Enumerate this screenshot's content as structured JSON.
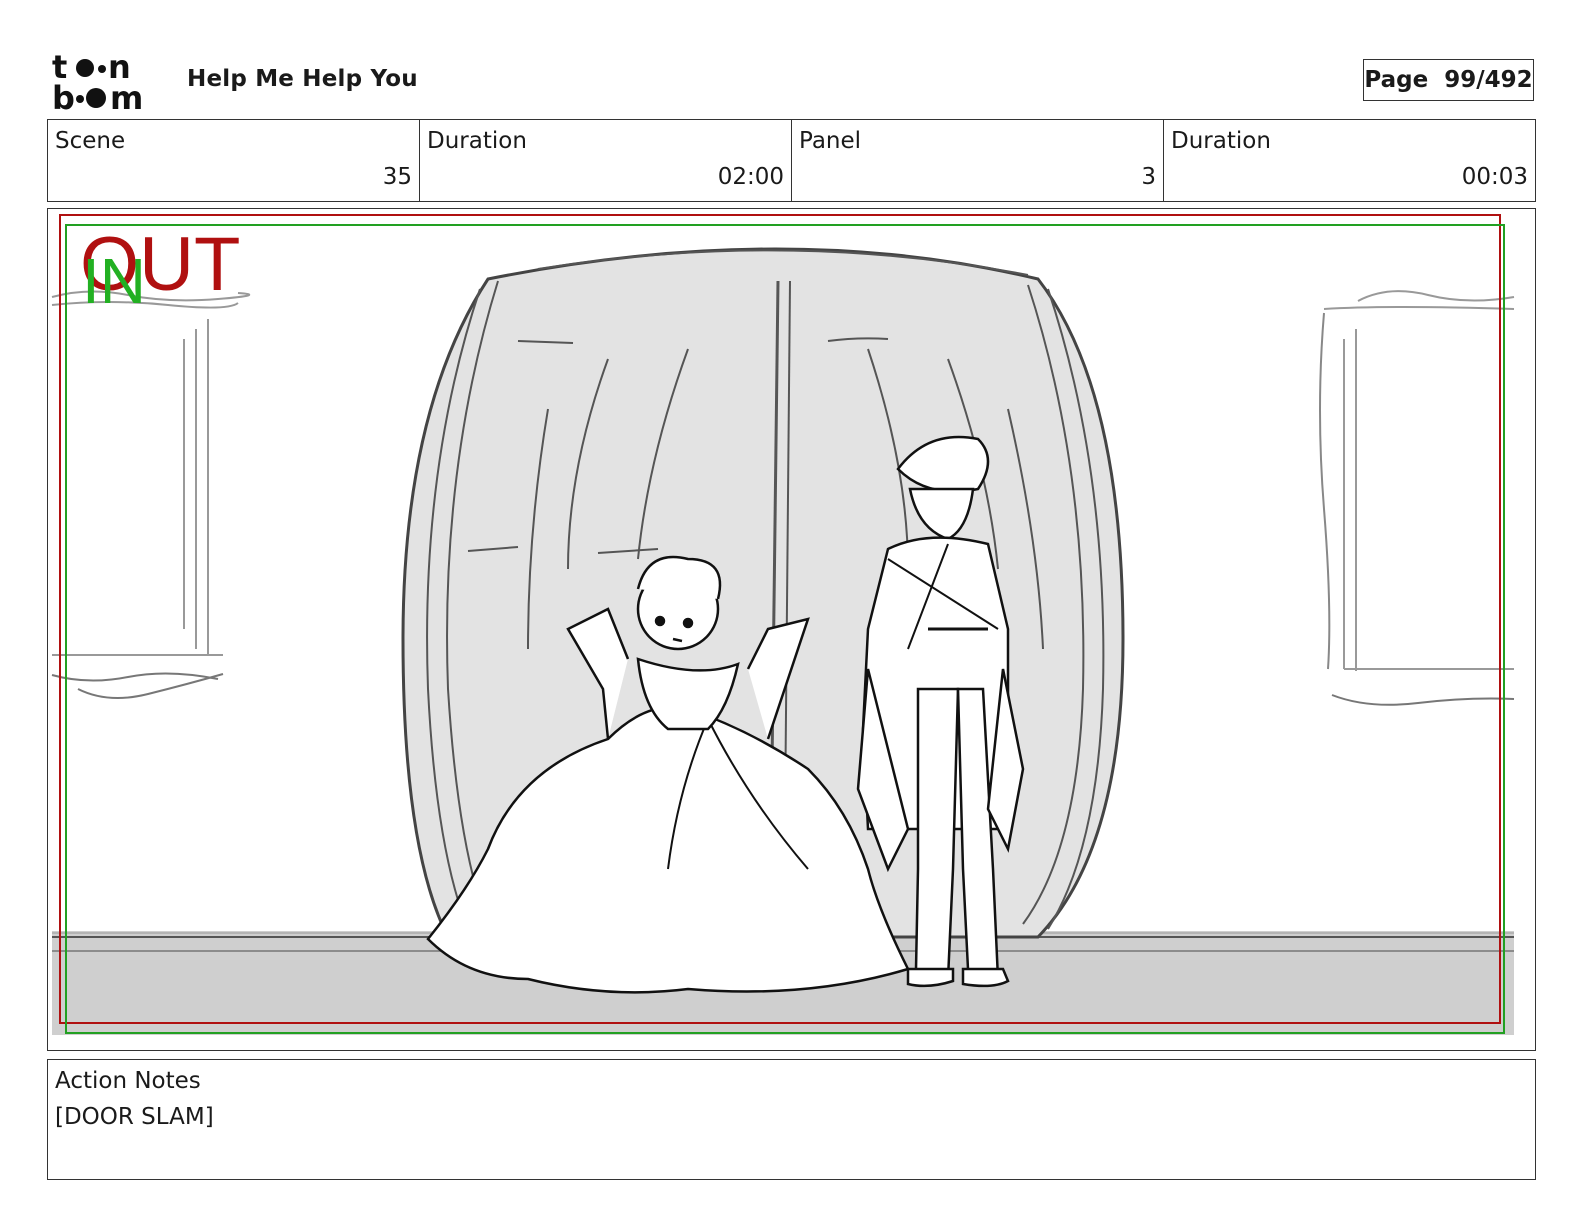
{
  "header": {
    "logo_text": "toonboom",
    "logo_icon": "toon-boom-logo-icon",
    "project_title": "Help Me Help You",
    "page_label": "Page  99/492"
  },
  "info": {
    "scene_label": "Scene",
    "scene_value": "35",
    "scene_duration_label": "Duration",
    "scene_duration_value": "02:00",
    "panel_label": "Panel",
    "panel_value": "3",
    "panel_duration_label": "Duration",
    "panel_duration_value": "00:03"
  },
  "frame": {
    "out_marker": "OUT",
    "in_marker": "IN",
    "out_color": "#b01010",
    "in_color": "#22b022"
  },
  "notes": {
    "label": "Action Notes",
    "text": "[DOOR SLAM]"
  }
}
